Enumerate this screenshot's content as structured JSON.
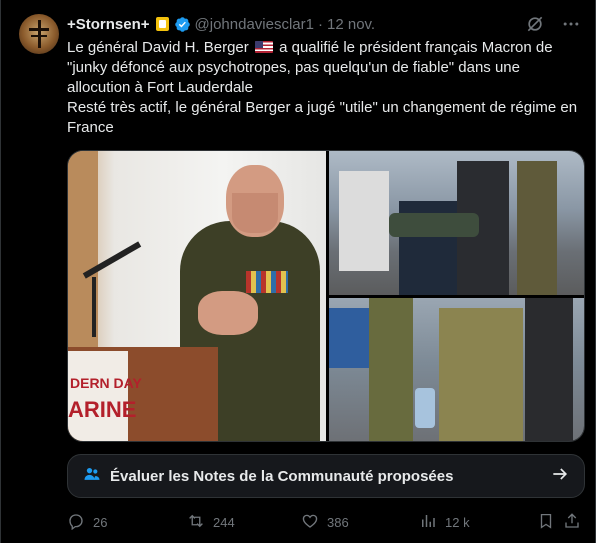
{
  "tweet": {
    "display_name": "+Stornsen+",
    "handle": "@johndaviesclar1",
    "separator": "·",
    "date": "12 nov.",
    "text_line1_before_flag": "Le général David H. Berger",
    "text_line1_after_flag": "a qualifié le président français Macron de \"junky défoncé aux psychotropes, pas quelqu'un de fiable\" dans une allocution à Fort Lauderdale",
    "text_line2": "Resté très actif, le général Berger a jugé \"utile\" un changement de régime en France",
    "flag_icon": "us-flag-icon"
  },
  "media": {
    "photo1_sign_line1": "DERN DAY",
    "photo1_sign_line2": "ARINE"
  },
  "notes": {
    "label": "Évaluer les Notes de la Communauté proposées",
    "icon": "community-notes-icon"
  },
  "actions": {
    "replies": "26",
    "retweets": "244",
    "likes": "386",
    "views": "12 k"
  },
  "colors": {
    "background": "#000000",
    "text": "#e7e9ea",
    "muted": "#71767b",
    "accent": "#1d9bf0",
    "notes_bg": "#16181c"
  }
}
